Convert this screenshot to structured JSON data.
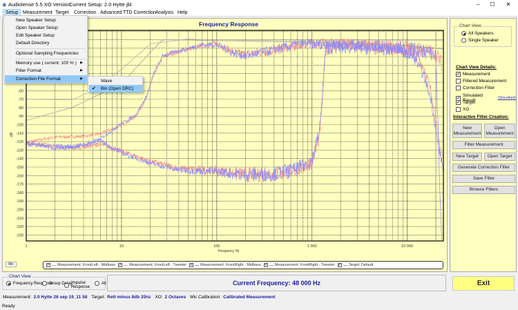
{
  "window": {
    "app_title": "Audiolense 5.5 XO Version.",
    "current_setup": "Current Setup: 2.0 Hytte jbl",
    "minimize": "–",
    "maximize": "☐",
    "close": "✕"
  },
  "menubar": [
    "Setup",
    "Measurement",
    "Target",
    "Correction",
    "Advanced TTD Correction",
    "Analysis",
    "Help"
  ],
  "setup_menu": {
    "items": [
      "New Speaker Setup",
      "Open Speaker Setup",
      "Edit Speaker Setup",
      "Default Directory",
      "Optional Sampling Frequencies",
      "Memory use ( current: 100 % )",
      "Filter Format",
      "Correction File Format"
    ],
    "arrow": "▶"
  },
  "submenu": {
    "items": [
      "Wave",
      "Bin (Open DRC)"
    ],
    "checked": "✔"
  },
  "colors": {
    "chart_bg": "#ffffc0",
    "left": "#f48a8a",
    "right": "#8a8aff",
    "target": "#a0a0a0",
    "title": "#1a1aa8"
  },
  "chart_data": {
    "type": "line",
    "title": "Frequency Response",
    "xlabel": "Frequency Hz",
    "ylabel": "dB",
    "xscale": "log",
    "xlim": [
      1,
      24000
    ],
    "ylim": [
      -237,
      11
    ],
    "xticks": [
      1,
      10,
      100,
      1000,
      10000
    ],
    "xtick_labels": [
      "1",
      "10",
      "100",
      "1 000",
      "10 000"
    ],
    "yticks": [
      -60,
      -70,
      -80,
      -90,
      -100,
      -110,
      -120,
      -130,
      -140,
      -150,
      -160,
      -170,
      -180,
      -190,
      -200,
      -210,
      -220,
      -230
    ],
    "grid": true,
    "series": [
      {
        "name": "Measurement: FrontLeft - Midbass",
        "color": "#f48a8a",
        "noise_db": 6,
        "points": [
          [
            1,
            -120
          ],
          [
            2,
            -114
          ],
          [
            4,
            -113
          ],
          [
            6,
            -110
          ],
          [
            10,
            -100
          ],
          [
            14,
            -90
          ],
          [
            18,
            -70
          ],
          [
            22,
            -40
          ],
          [
            27,
            -20
          ],
          [
            35,
            -15
          ],
          [
            50,
            -10
          ],
          [
            70,
            -6
          ],
          [
            100,
            -3
          ],
          [
            150,
            -13
          ],
          [
            200,
            -15
          ],
          [
            300,
            -12
          ],
          [
            500,
            -8
          ],
          [
            800,
            -3
          ],
          [
            1300,
            -2
          ],
          [
            3000,
            -3
          ],
          [
            8000,
            -8
          ],
          [
            12000,
            -14
          ],
          [
            15000,
            -30
          ],
          [
            18000,
            -60
          ],
          [
            21000,
            -110
          ],
          [
            24000,
            -140
          ]
        ]
      },
      {
        "name": "Measurement: FrontLeft - Tweeter",
        "color": "#f48a8a",
        "noise_db": 9,
        "points": [
          [
            1,
            -120
          ],
          [
            3,
            -127
          ],
          [
            6,
            -122
          ],
          [
            10,
            -130
          ],
          [
            20,
            -142
          ],
          [
            40,
            -150
          ],
          [
            100,
            -152
          ],
          [
            200,
            -155
          ],
          [
            400,
            -155
          ],
          [
            700,
            -150
          ],
          [
            1000,
            -140
          ],
          [
            1200,
            -110
          ],
          [
            1300,
            -60
          ],
          [
            1400,
            -6
          ],
          [
            2000,
            -3
          ],
          [
            5000,
            -5
          ],
          [
            10000,
            -7
          ],
          [
            15000,
            -9
          ],
          [
            20000,
            -12
          ],
          [
            23000,
            -25
          ]
        ]
      },
      {
        "name": "Measurement: FrontRight - Midbass",
        "color": "#8a8aff",
        "noise_db": 6,
        "points": [
          [
            1,
            -120
          ],
          [
            2,
            -128
          ],
          [
            4,
            -124
          ],
          [
            6,
            -116
          ],
          [
            10,
            -98
          ],
          [
            14,
            -88
          ],
          [
            18,
            -68
          ],
          [
            22,
            -38
          ],
          [
            27,
            -18
          ],
          [
            35,
            -14
          ],
          [
            50,
            -9
          ],
          [
            70,
            -5
          ],
          [
            100,
            -4
          ],
          [
            150,
            -14
          ],
          [
            200,
            -16
          ],
          [
            300,
            -13
          ],
          [
            500,
            -7
          ],
          [
            800,
            -2
          ],
          [
            1300,
            -3
          ],
          [
            3000,
            -4
          ],
          [
            8000,
            -9
          ],
          [
            12000,
            -20
          ],
          [
            15000,
            -40
          ],
          [
            18000,
            -70
          ],
          [
            21000,
            -120
          ],
          [
            24000,
            -150
          ]
        ]
      },
      {
        "name": "Measurement: FrontRight - Tweeter",
        "color": "#8a8aff",
        "noise_db": 9,
        "points": [
          [
            1,
            -122
          ],
          [
            3,
            -125
          ],
          [
            6,
            -118
          ],
          [
            10,
            -132
          ],
          [
            20,
            -144
          ],
          [
            40,
            -152
          ],
          [
            100,
            -153
          ],
          [
            200,
            -156
          ],
          [
            400,
            -154
          ],
          [
            700,
            -149
          ],
          [
            1000,
            -138
          ],
          [
            1200,
            -105
          ],
          [
            1300,
            -55
          ],
          [
            1400,
            -5
          ],
          [
            2000,
            -4
          ],
          [
            5000,
            -6
          ],
          [
            10000,
            -8
          ],
          [
            15000,
            -10
          ],
          [
            20000,
            -14
          ],
          [
            23000,
            -240
          ]
        ]
      },
      {
        "name": "Target: Default",
        "color": "#a0a0a0",
        "noise_db": 0,
        "points": [
          [
            1,
            -95
          ],
          [
            3,
            -80
          ],
          [
            10,
            -52
          ],
          [
            20,
            -15
          ],
          [
            27,
            0
          ],
          [
            100,
            -1
          ],
          [
            1000,
            -3
          ],
          [
            10000,
            -7
          ],
          [
            24000,
            -11
          ]
        ]
      },
      {
        "name": "Simulated Result",
        "color": "#b8b0b0",
        "noise_db": 0,
        "points": [
          [
            1,
            -70
          ],
          [
            3,
            -71
          ],
          [
            5,
            -60
          ],
          [
            10,
            -35
          ],
          [
            20,
            -5
          ],
          [
            50,
            1
          ],
          [
            100,
            -1
          ],
          [
            24000,
            -1
          ]
        ]
      }
    ]
  },
  "legend": [
    "Measurement: FrontLeft - Midbass",
    "Measurement: FrontLeft - Tweeter",
    "Measurement: FrontRight - Midbass",
    "Measurement: FrontRight - Tweeter",
    "Target: Default"
  ],
  "legend_check": "✔",
  "min_button": "Min",
  "right_panel": {
    "chart_view_title": "Chart View",
    "all_speakers": "All Speakers",
    "single_speaker": "Single Speaker",
    "details_title": "Chart View Details:",
    "details": [
      {
        "label": "Measurement",
        "checked": "✔"
      },
      {
        "label": "Filtered Measurement",
        "checked": ""
      },
      {
        "label": "Correction Filter",
        "checked": ""
      },
      {
        "label": "Simulated Result",
        "checked": "✔"
      },
      {
        "label": "Target",
        "checked": "✔"
      },
      {
        "label": "XO",
        "checked": ""
      }
    ],
    "smoothed_link": "(Smoothed)",
    "filter_title": "Interactive Filter Creation:",
    "new_measurement": "New Measurement",
    "open_measurement": "Open Measurement",
    "filter_measurement": "Filter Measurement",
    "new_target": "New Target",
    "open_target": "Open Target",
    "generate": "Generate Correction Filter",
    "save": "Save Filter",
    "browse": "Browse Filters"
  },
  "bottom": {
    "chart_view_title": "Chart View",
    "options": [
      "Frequency Response",
      "Group Delay",
      "Impulse Response",
      "All"
    ],
    "current_frequency": "Current Frequency: 48 000 Hz",
    "exit": "Exit"
  },
  "status": {
    "measurement_label": "Measurement:",
    "measurement": "2.0 Hytte 26 sep 19_11 58",
    "target_label": "Target:",
    "target": "Rett minus 8db 25hz",
    "xo_label": "XO:",
    "xo": "2 Octaves",
    "mic_label": "Mic Calibration:",
    "mic": "Calibrated Measurement",
    "ready": "Ready"
  }
}
